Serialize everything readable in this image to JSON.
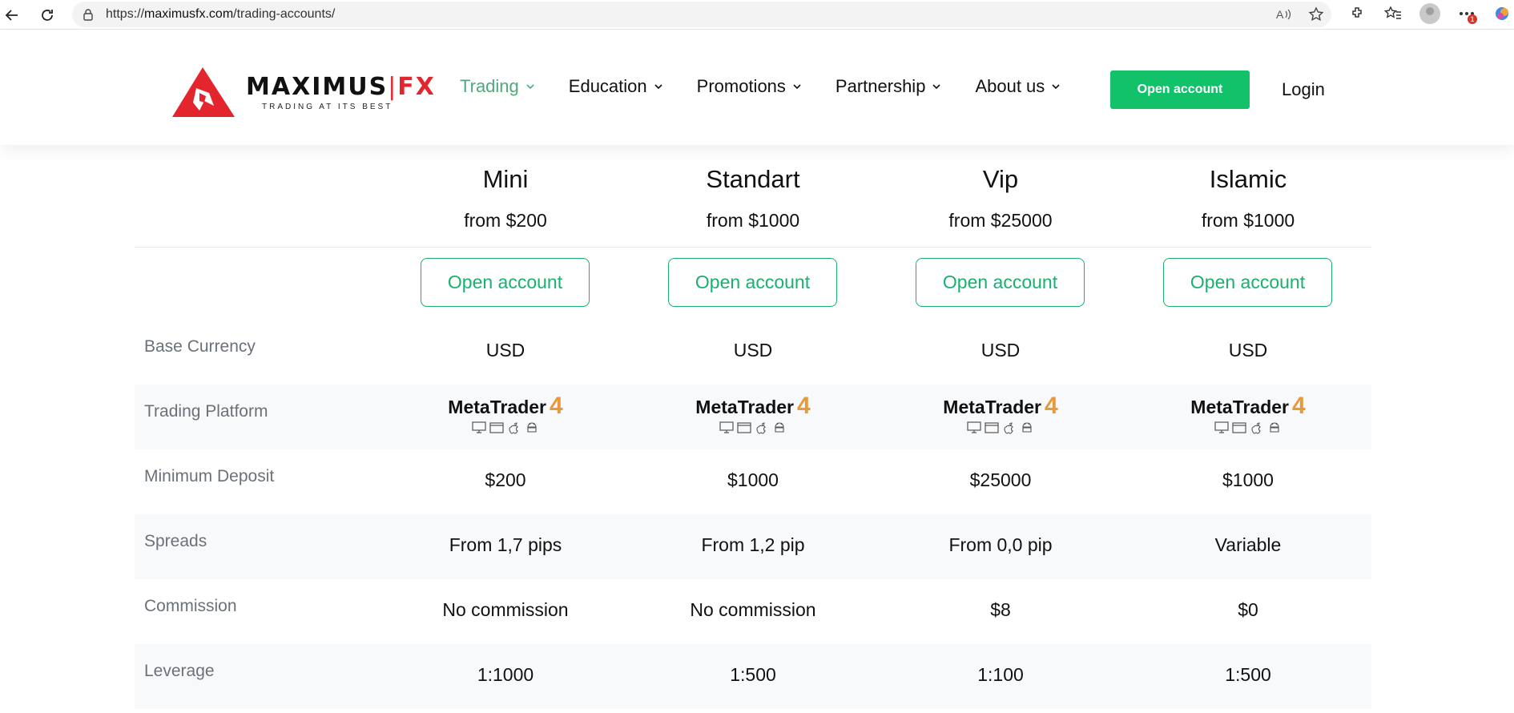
{
  "browser": {
    "url_prefix": "https://",
    "url_host": "maximusfx.com",
    "url_path": "/trading-accounts/",
    "badge_count": "1"
  },
  "header": {
    "logo_brand_main": "MAXIMUS",
    "logo_brand_sep": "|",
    "logo_brand_fx": "FX",
    "logo_tagline": "TRADING AT ITS BEST",
    "nav": [
      "Trading",
      "Education",
      "Promotions",
      "Partnership",
      "About us"
    ],
    "open_account": "Open account",
    "login": "Login"
  },
  "accounts": [
    {
      "name": "Mini",
      "from": "from $200"
    },
    {
      "name": "Standart",
      "from": "from $1000"
    },
    {
      "name": "Vip",
      "from": "from $25000"
    },
    {
      "name": "Islamic",
      "from": "from $1000"
    }
  ],
  "open_button_label": "Open account",
  "platform": {
    "name": "MetaTrader",
    "version": "4"
  },
  "rows": [
    {
      "label": "Base Currency",
      "values": [
        "USD",
        "USD",
        "USD",
        "USD"
      ]
    },
    {
      "label": "Trading Platform",
      "values": []
    },
    {
      "label": "Minimum Deposit",
      "values": [
        "$200",
        "$1000",
        "$25000",
        "$1000"
      ]
    },
    {
      "label": "Spreads",
      "values": [
        "From 1,7 pips",
        "From 1,2 pip",
        "From 0,0 pip",
        "Variable"
      ]
    },
    {
      "label": "Commission",
      "values": [
        "No commission",
        "No commission",
        "$8",
        "$0"
      ]
    },
    {
      "label": "Leverage",
      "values": [
        "1:1000",
        "1:500",
        "1:100",
        "1:500"
      ]
    }
  ],
  "colors": {
    "accent_green": "#12c26b",
    "outline_green": "#19b070",
    "brand_red": "#e3262d",
    "mt_orange": "#e69a3b"
  }
}
